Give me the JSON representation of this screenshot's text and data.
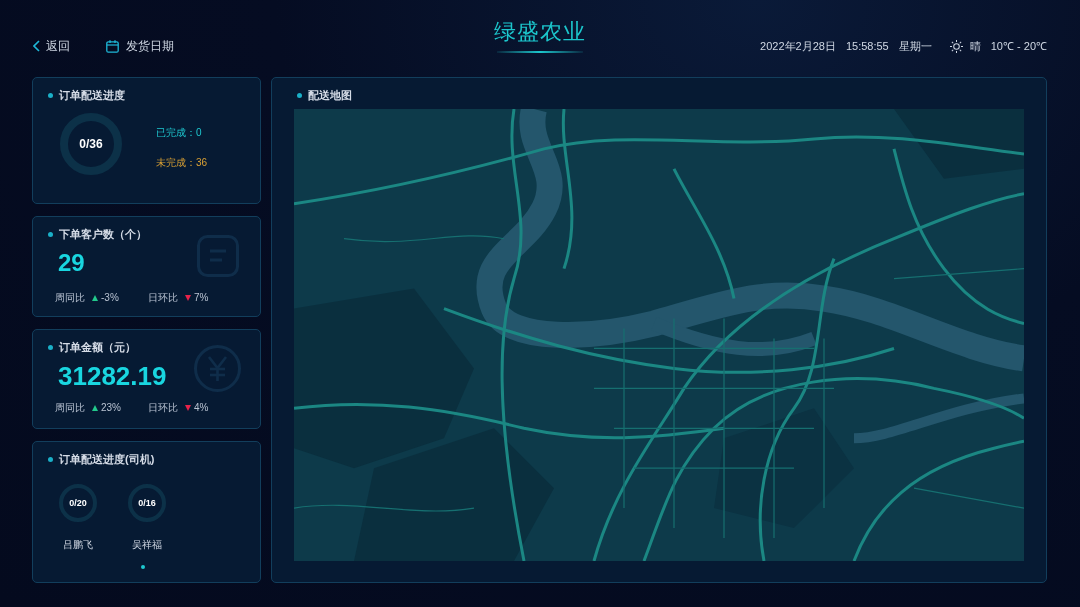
{
  "header": {
    "back": {
      "label": "返回"
    },
    "date_button": {
      "label": "发货日期"
    },
    "title": "绿盛农业",
    "date": "2022年2月28日",
    "time": "15:58:55",
    "weekday": "星期一",
    "weather": {
      "condition": "晴",
      "temperature": "10℃ - 20℃"
    }
  },
  "delivery_progress": {
    "title": "订单配送进度",
    "ring": {
      "label": "0/36"
    },
    "stats": [
      {
        "kind": "completed",
        "label": "已完成：0"
      },
      {
        "kind": "pending",
        "label": "未完成：36"
      }
    ]
  },
  "metrics": [
    {
      "kind": "customers",
      "title": "下单客户数（个）",
      "value": "29",
      "comparisons": [
        {
          "label": "周同比",
          "kind": "up",
          "value": "-3%"
        },
        {
          "label": "日环比",
          "kind": "down",
          "value": "7%"
        }
      ]
    },
    {
      "kind": "amount",
      "title": "订单金额（元）",
      "value": "31282.19",
      "comparisons": [
        {
          "label": "周同比",
          "kind": "up",
          "value": "23%"
        },
        {
          "label": "日环比",
          "kind": "down",
          "value": "4%"
        }
      ]
    }
  ],
  "drivers": {
    "title": "订单配送进度(司机)",
    "items": [
      {
        "name": "吕鹏飞",
        "ring": {
          "label": "0/20"
        }
      },
      {
        "name": "吴祥福",
        "ring": {
          "label": "0/16"
        }
      }
    ]
  },
  "map": {
    "title": "配送地图"
  }
}
